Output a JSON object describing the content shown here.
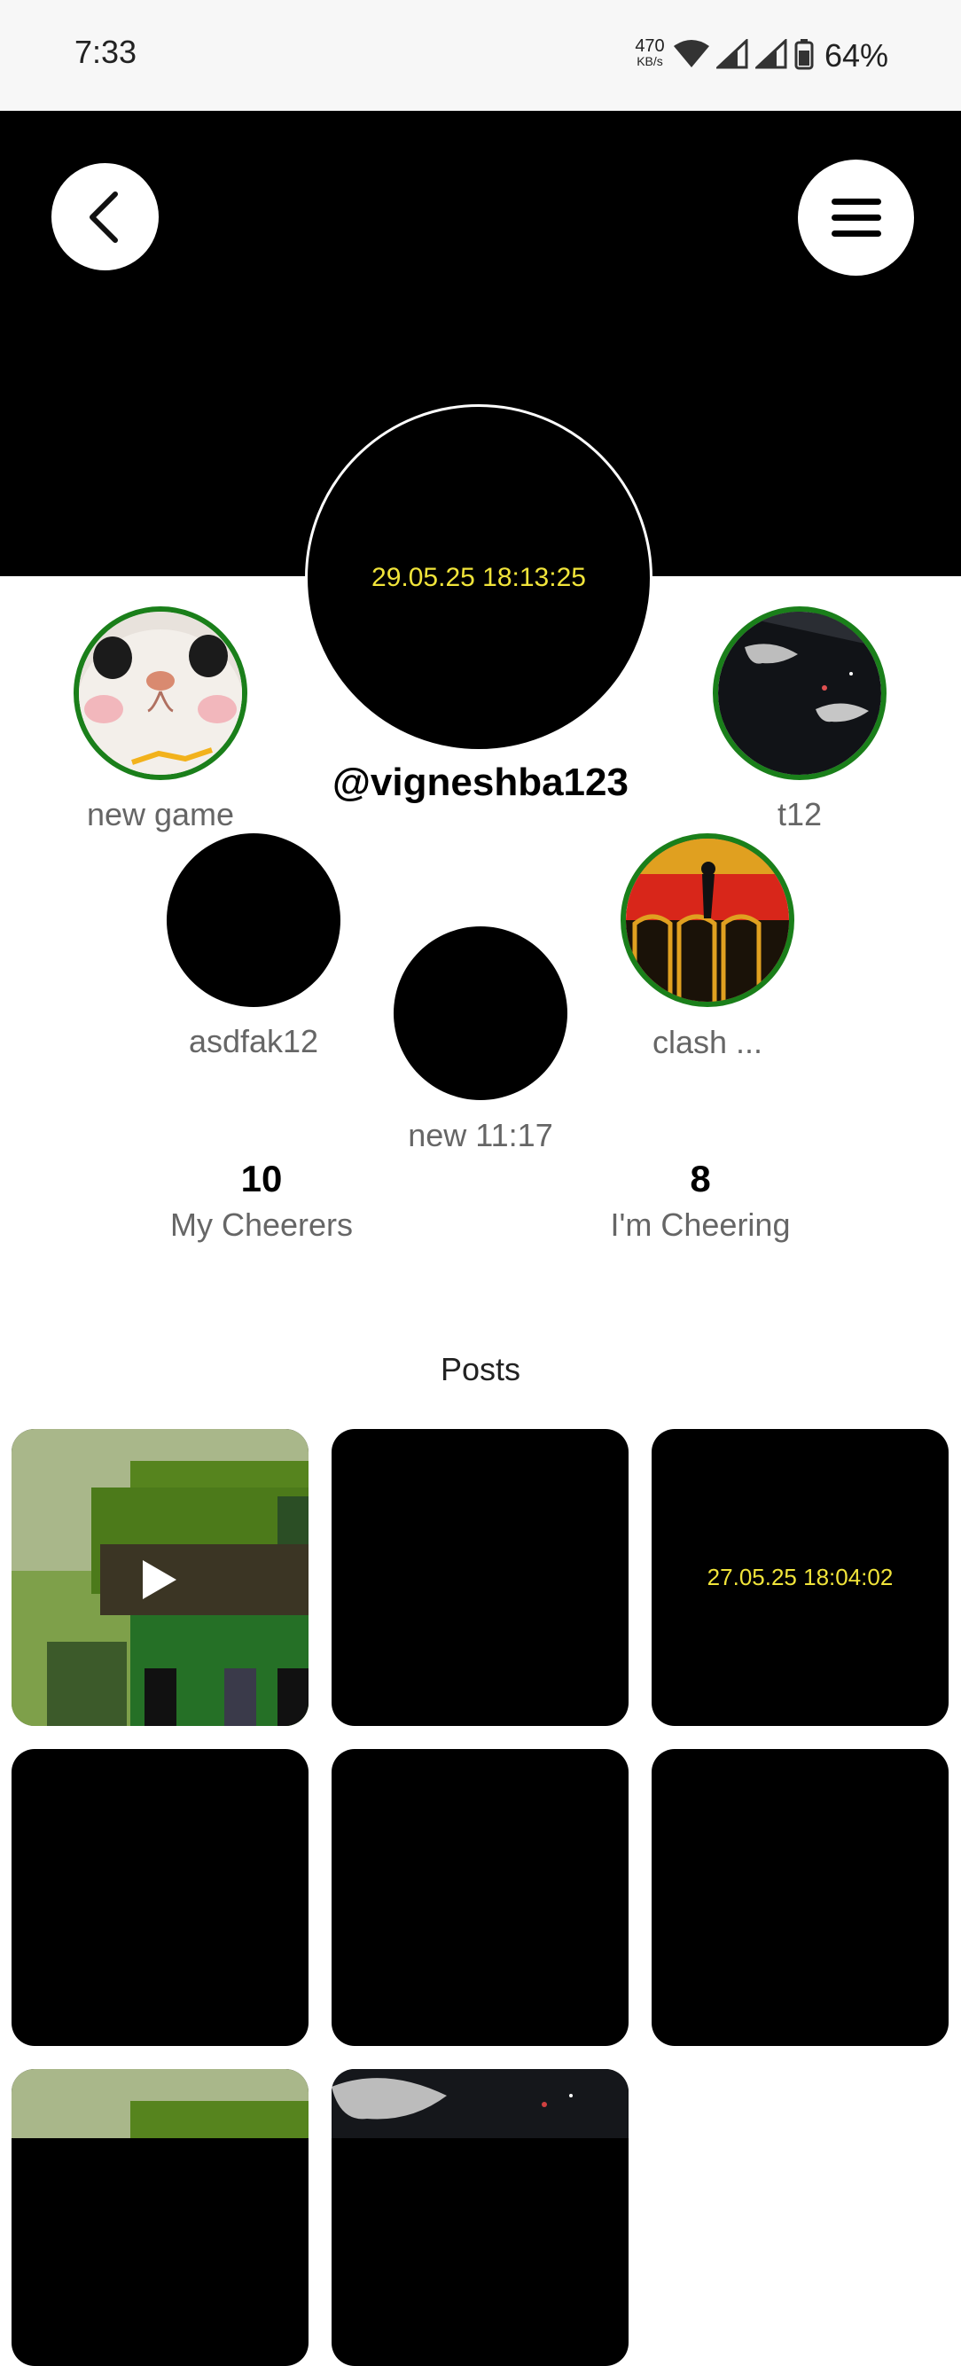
{
  "status_bar": {
    "time": "7:33",
    "net_speed": "470",
    "net_unit": "KB/s",
    "battery": "64%",
    "icons": [
      "wifi-icon",
      "signal-icon",
      "signal-icon",
      "battery-icon"
    ]
  },
  "header": {
    "back_icon": "chevron-left-icon",
    "menu_icon": "hamburger-menu-icon"
  },
  "profile": {
    "avatar_text": "29.05.25 18:13:25",
    "username": "@vigneshba123"
  },
  "friends": [
    {
      "label": "new game"
    },
    {
      "label": "t12"
    },
    {
      "label": "asdfak12"
    },
    {
      "label": "clash ..."
    },
    {
      "label": "new 11:17"
    }
  ],
  "stats": {
    "cheerers_count": "10",
    "cheerers_label": "My Cheerers",
    "cheering_count": "8",
    "cheering_label": "I'm Cheering"
  },
  "posts": {
    "title": "Posts",
    "tiles": [
      {
        "kind": "video"
      },
      {
        "kind": "blank"
      },
      {
        "kind": "text",
        "text": "27.05.25 18:04:02"
      },
      {
        "kind": "blank"
      },
      {
        "kind": "blank"
      },
      {
        "kind": "blank"
      },
      {
        "kind": "image"
      },
      {
        "kind": "image"
      }
    ]
  },
  "colors": {
    "accent_yellow": "#f1e43a",
    "ring_green": "#1a7f1a"
  }
}
